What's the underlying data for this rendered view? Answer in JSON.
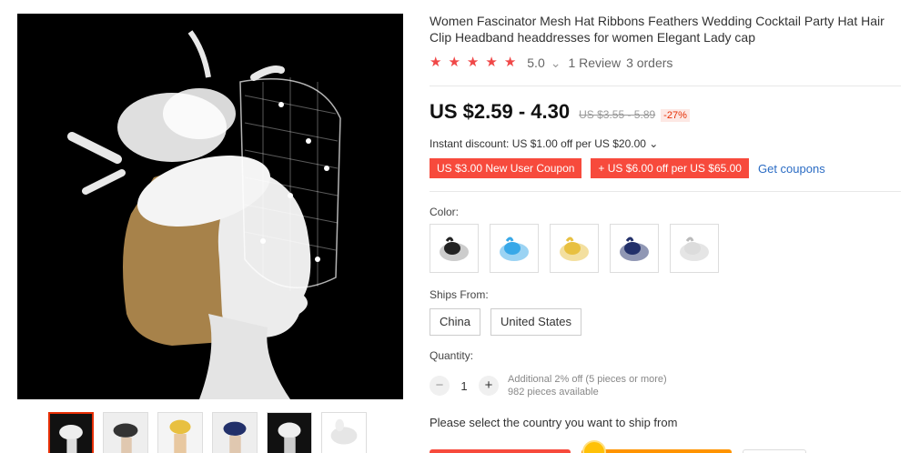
{
  "product": {
    "title": "Women Fascinator Mesh Hat Ribbons Feathers Wedding Cocktail Party Hat Hair Clip Headband headdresses for women Elegant Lady cap"
  },
  "rating": {
    "stars": 5,
    "score": "5.0",
    "chevron": "⌄",
    "reviews": "1 Review",
    "orders": "3 orders"
  },
  "price": {
    "current": "US $2.59 - 4.30",
    "original": "US $3.55 - 5.89",
    "discount": "-27%"
  },
  "instant_discount": "Instant discount: US $1.00 off per US $20.00 ⌄",
  "coupons": [
    {
      "label": "US $3.00 New User Coupon"
    },
    {
      "label": "+ US $6.00 off per US $65.00"
    }
  ],
  "get_coupons": "Get coupons",
  "color": {
    "label": "Color:",
    "options": [
      "black",
      "light-blue",
      "yellow",
      "navy",
      "white"
    ],
    "colors": [
      "#222222",
      "#38a8e8",
      "#e8c040",
      "#22306a",
      "#dcdcdc"
    ]
  },
  "ships_from": {
    "label": "Ships From:",
    "options": [
      "China",
      "United States"
    ]
  },
  "quantity": {
    "label": "Quantity:",
    "value": "1",
    "minus": "−",
    "plus": "+",
    "additional": "Additional 2% off (5 pieces or more)",
    "available": "982 pieces available"
  },
  "ship_prompt": "Please select the country you want to ship from",
  "accent": "#f74a3c"
}
